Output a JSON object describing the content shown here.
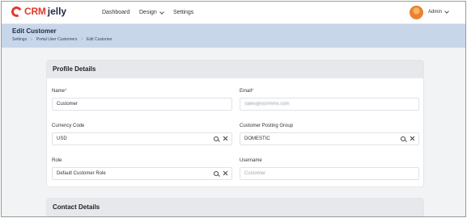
{
  "brand": {
    "crm": "CRM",
    "jelly": "jelly"
  },
  "nav": {
    "dashboard": "Dashboard",
    "design": "Design",
    "settings": "Settings"
  },
  "user": {
    "name": "Admin"
  },
  "page": {
    "title": "Edit Customer",
    "breadcrumb": [
      "Settings",
      "Portal User Customers",
      "Edit Customer"
    ]
  },
  "profile": {
    "title": "Profile Details",
    "name_label": "Name",
    "name_value": "Customer",
    "email_label": "Email",
    "email_value": "sales@iscrmmx.com",
    "currency_label": "Currency Code",
    "currency_value": "USD",
    "posting_label": "Customer Posting Group",
    "posting_value": "DOMESTIC",
    "role_label": "Role",
    "role_value": "Default Customer Role",
    "username_label": "Username",
    "username_placeholder": "Customer"
  },
  "contact": {
    "title": "Contact Details"
  },
  "colors": {
    "accent_red": "#e23a2e",
    "header_band": "#c8d6ea",
    "brand_navy": "#1f2a44"
  }
}
